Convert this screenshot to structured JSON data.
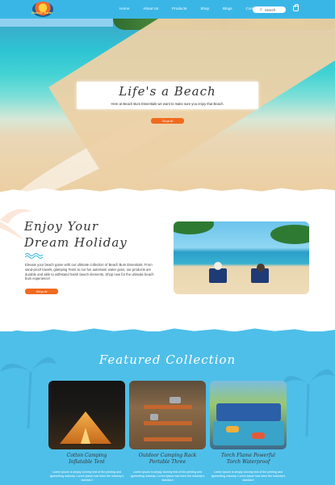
{
  "header": {
    "logo_text": "Beach Bum",
    "nav": [
      "Home",
      "About Us",
      "Products",
      "Shop",
      "Blogs",
      "Contact Us"
    ],
    "search_placeholder": "Search",
    "colors": {
      "bar": "#3ab6e6",
      "accent": "#f06a1f"
    },
    "icons": [
      "logo-icon",
      "search-icon",
      "cart-icon"
    ]
  },
  "hero": {
    "title": "Life's a Beach",
    "subtitle": "Here at Beach Bum Essentials we want to make sure you enjoy that Beach.",
    "button": "Shop At"
  },
  "enjoy": {
    "title_line1": "Enjoy Your",
    "title_line2": "Dream Holiday",
    "text": "Elevate your beach game with our ultimate collection of Beach Bum Essentials. From sand-proof towels, glamping Tents to our fun automatic water guns, our products are durable and able to withstand harsh beach elements. Shop now for the ultimate beach bum experience!",
    "button": "Shop At"
  },
  "featured": {
    "title": "Featured Collection",
    "products": [
      {
        "name_line1": "Cotton Camping",
        "name_line2": "Inflatable Tent",
        "desc": "Lorem Ipsum is simply dummy text of the printing and typesetting industry. Lorem Ipsum has been the industry's standard"
      },
      {
        "name_line1": "Outdoor Camping Rack",
        "name_line2": "Portable Three",
        "desc": "Lorem Ipsum is simply dummy text of the printing and typesetting industry. Lorem Ipsum has been the industry's standard"
      },
      {
        "name_line1": "Torch Flame Powerful",
        "name_line2": "Torch Waterproof",
        "desc": "Lorem Ipsum is simply dummy text of the printing and typesetting industry. Lorem Ipsum has been the industry's standard"
      }
    ]
  }
}
